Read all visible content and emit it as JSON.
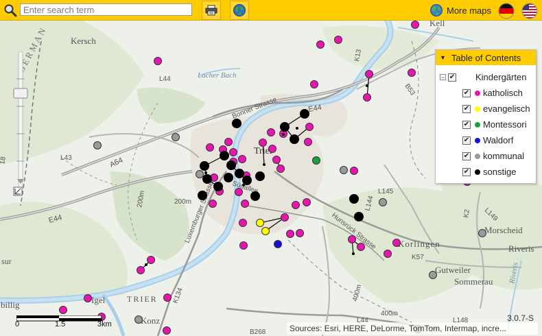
{
  "toolbar": {
    "search_placeholder": "Enter search term",
    "more_maps_label": "More maps",
    "accent_color": "#ffcc00"
  },
  "toc": {
    "title": "Table of Contents",
    "group_label": "Kindergärten",
    "layers": [
      {
        "label": "katholisch",
        "color": "#e815b0"
      },
      {
        "label": "evangelisch",
        "color": "#ffff00"
      },
      {
        "label": "Montessori",
        "color": "#1e9e3a"
      },
      {
        "label": "Waldorf",
        "color": "#1414d8"
      },
      {
        "label": "kommunal",
        "color": "#9a9a9a"
      },
      {
        "label": "sonstige",
        "color": "#000000"
      }
    ]
  },
  "map_labels": {
    "kersch": "Kersch",
    "trier": "Trier",
    "trier_region": "TRIER",
    "korlingen": "Korlingen",
    "morscheid": "Morscheid",
    "riveris": "Riveris",
    "riveris_river": "Riveris",
    "gutweiler": "Gutweiler",
    "sommerau": "Sommerau",
    "igel": "Igel",
    "wasserbillig": "billig",
    "konz": "Konz",
    "kell": "Kell",
    "lacher_bach": "Lacher Bach",
    "bonner_strasse": "Bonner Strasse",
    "luxemburger_strasse": "Luxemburger Strasse",
    "hunsrueck_strasse": "Hunsrück Strasse",
    "suedallee": "Südallee",
    "german_text": "GERMAN",
    "a64": "A64",
    "e44_north": "E44",
    "e44_south": "E44",
    "l44": "L44",
    "k13": "K13",
    "l43": "L43",
    "b268": "B268",
    "k134": "K134",
    "l145": "L145",
    "k2": "K2",
    "l149": "L149",
    "k57": "K57",
    "k18": "18",
    "l144": "L144",
    "b53": "B53",
    "sur": "sur",
    "el_200m": "200m",
    "el_400m": "400m",
    "el_200m_b": "200m",
    "el_400m_b": "400m",
    "l44_south": "L44",
    "l148": "L148"
  },
  "scalebar": {
    "labels": [
      "0",
      "1.5",
      "3km"
    ]
  },
  "version": "3.0.7-S",
  "attribution": "Sources: Esri, HERE, DeLorme, TomTom, Intermap, incre...",
  "markers": [
    {
      "type": "katholisch",
      "lon": 605,
      "lat": 36
    },
    {
      "type": "katholisch",
      "lon": 493,
      "lat": 58
    },
    {
      "type": "katholisch",
      "lon": 467,
      "lat": 65
    },
    {
      "type": "katholisch",
      "lon": 230,
      "lat": 89
    },
    {
      "type": "katholisch",
      "lon": 538,
      "lat": 108
    },
    {
      "type": "katholisch",
      "lon": 600,
      "lat": 106
    },
    {
      "type": "katholisch",
      "lon": 458,
      "lat": 123
    },
    {
      "type": "katholisch",
      "lon": 535,
      "lat": 142
    },
    {
      "type": "katholisch",
      "lon": 451,
      "lat": 185
    },
    {
      "type": "katholisch",
      "lon": 395,
      "lat": 193
    },
    {
      "type": "katholisch",
      "lon": 413,
      "lat": 195
    },
    {
      "type": "katholisch",
      "lon": 383,
      "lat": 208
    },
    {
      "type": "katholisch",
      "lon": 333,
      "lat": 207
    },
    {
      "type": "katholisch",
      "lon": 306,
      "lat": 215
    },
    {
      "type": "katholisch",
      "lon": 325,
      "lat": 218
    },
    {
      "type": "katholisch",
      "lon": 449,
      "lat": 207
    },
    {
      "type": "katholisch",
      "lon": 397,
      "lat": 217
    },
    {
      "type": "katholisch",
      "lon": 340,
      "lat": 222
    },
    {
      "type": "katholisch",
      "lon": 353,
      "lat": 232
    },
    {
      "type": "katholisch",
      "lon": 403,
      "lat": 233
    },
    {
      "type": "katholisch",
      "lon": 340,
      "lat": 236
    },
    {
      "type": "katholisch",
      "lon": 409,
      "lat": 246
    },
    {
      "type": "katholisch",
      "lon": 516,
      "lat": 249
    },
    {
      "type": "katholisch",
      "lon": 312,
      "lat": 259
    },
    {
      "type": "katholisch",
      "lon": 359,
      "lat": 256
    },
    {
      "type": "katholisch",
      "lon": 320,
      "lat": 279
    },
    {
      "type": "katholisch",
      "lon": 348,
      "lat": 280
    },
    {
      "type": "katholisch",
      "lon": 681,
      "lat": 265
    },
    {
      "type": "katholisch",
      "lon": 310,
      "lat": 297
    },
    {
      "type": "katholisch",
      "lon": 357,
      "lat": 297
    },
    {
      "type": "katholisch",
      "lon": 447,
      "lat": 295
    },
    {
      "type": "katholisch",
      "lon": 431,
      "lat": 299
    },
    {
      "type": "katholisch",
      "lon": 415,
      "lat": 317
    },
    {
      "type": "katholisch",
      "lon": 354,
      "lat": 325
    },
    {
      "type": "katholisch",
      "lon": 437,
      "lat": 340
    },
    {
      "type": "katholisch",
      "lon": 423,
      "lat": 341
    },
    {
      "type": "katholisch",
      "lon": 513,
      "lat": 349
    },
    {
      "type": "katholisch",
      "lon": 578,
      "lat": 354
    },
    {
      "type": "katholisch",
      "lon": 355,
      "lat": 358
    },
    {
      "type": "katholisch",
      "lon": 526,
      "lat": 360
    },
    {
      "type": "katholisch",
      "lon": 565,
      "lat": 370
    },
    {
      "type": "katholisch",
      "lon": 220,
      "lat": 379
    },
    {
      "type": "katholisch",
      "lon": 205,
      "lat": 394
    },
    {
      "type": "katholisch",
      "lon": 128,
      "lat": 435
    },
    {
      "type": "katholisch",
      "lon": 244,
      "lat": 434
    },
    {
      "type": "katholisch",
      "lon": 92,
      "lat": 452
    },
    {
      "type": "katholisch",
      "lon": 148,
      "lat": 462
    },
    {
      "type": "katholisch",
      "lon": 243,
      "lat": 482
    },
    {
      "type": "evangelisch",
      "lon": 379,
      "lat": 325
    },
    {
      "type": "evangelisch",
      "lon": 387,
      "lat": 337
    },
    {
      "type": "Montessori",
      "lon": 461,
      "lat": 234
    },
    {
      "type": "Waldorf",
      "lon": 405,
      "lat": 356
    },
    {
      "type": "kommunal",
      "lon": 142,
      "lat": 212
    },
    {
      "type": "kommunal",
      "lon": 256,
      "lat": 200
    },
    {
      "type": "kommunal",
      "lon": 501,
      "lat": 248
    },
    {
      "type": "kommunal",
      "lon": 291,
      "lat": 254
    },
    {
      "type": "kommunal",
      "lon": 558,
      "lat": 295
    },
    {
      "type": "kommunal",
      "lon": 703,
      "lat": 340
    },
    {
      "type": "kommunal",
      "lon": 631,
      "lat": 401
    },
    {
      "type": "kommunal",
      "lon": 202,
      "lat": 466
    },
    {
      "type": "kommunal",
      "lon": 609,
      "lat": 480
    },
    {
      "type": "sonstige",
      "lon": 345,
      "lat": 180
    },
    {
      "type": "sonstige",
      "lon": 444,
      "lat": 166
    },
    {
      "type": "sonstige",
      "lon": 415,
      "lat": 185
    },
    {
      "type": "sonstige",
      "lon": 429,
      "lat": 203
    },
    {
      "type": "sonstige",
      "lon": 327,
      "lat": 227
    },
    {
      "type": "sonstige",
      "lon": 337,
      "lat": 241
    },
    {
      "type": "sonstige",
      "lon": 298,
      "lat": 242
    },
    {
      "type": "sonstige",
      "lon": 302,
      "lat": 261
    },
    {
      "type": "sonstige",
      "lon": 318,
      "lat": 272
    },
    {
      "type": "sonstige",
      "lon": 333,
      "lat": 259
    },
    {
      "type": "sonstige",
      "lon": 349,
      "lat": 253
    },
    {
      "type": "sonstige",
      "lon": 360,
      "lat": 263
    },
    {
      "type": "sonstige",
      "lon": 379,
      "lat": 257
    },
    {
      "type": "sonstige",
      "lon": 372,
      "lat": 286
    },
    {
      "type": "sonstige",
      "lon": 295,
      "lat": 285
    },
    {
      "type": "sonstige",
      "lon": 516,
      "lat": 290
    },
    {
      "type": "sonstige",
      "lon": 523,
      "lat": 316
    }
  ]
}
